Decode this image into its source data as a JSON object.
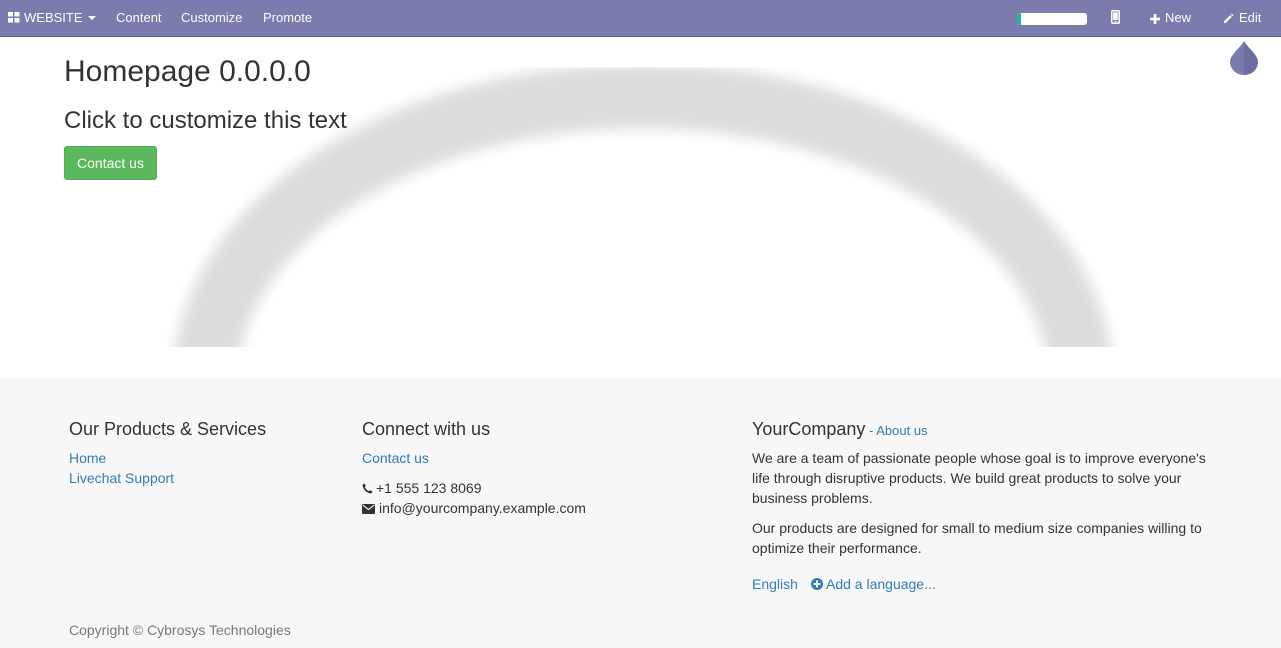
{
  "topbar": {
    "website_label": "WEBSITE",
    "menu": [
      "Content",
      "Customize",
      "Promote"
    ],
    "progress_fraction": 0.05,
    "new_label": "New",
    "edit_label": "Edit"
  },
  "hero": {
    "title": "Homepage 0.0.0.0",
    "subtitle": "Click to customize this text",
    "button_label": "Contact us"
  },
  "footer": {
    "products": {
      "heading": "Our Products & Services",
      "links": [
        "Home",
        "Livechat Support"
      ]
    },
    "connect": {
      "heading": "Connect with us",
      "contact_link": "Contact us",
      "phone": "+1 555 123 8069",
      "email": "info@yourcompany.example.com"
    },
    "company": {
      "name": "YourCompany",
      "about_prefix": " - ",
      "about_link": "About us",
      "paragraph1": "We are a team of passionate people whose goal is to improve everyone's life through disruptive products. We build great products to solve your business problems.",
      "paragraph2": "Our products are designed for small to medium size companies willing to optimize their performance.",
      "language": "English",
      "add_language": "Add a language..."
    },
    "copyright": "Copyright © Cybrosys Technologies"
  },
  "colors": {
    "topbar": "#7c7bad",
    "link": "#337ab7",
    "button": "#5cb85c",
    "footer_bg": "#f7f7f7",
    "progress": "#21b799"
  },
  "icons": [
    "apps-grid-icon",
    "caret-down-icon",
    "mobile-icon",
    "plus-icon",
    "pencil-icon",
    "drop-icon",
    "phone-icon",
    "envelope-icon",
    "plus-circle-icon"
  ]
}
